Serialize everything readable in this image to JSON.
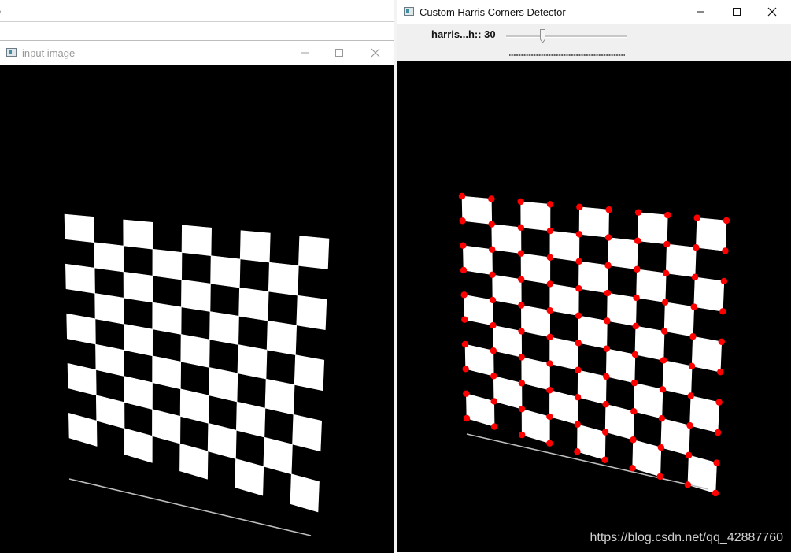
{
  "background_window": {
    "title_fragment": ","
  },
  "input_window": {
    "title": "input image",
    "icons": [
      "window-app-icon",
      "minimize-icon",
      "maximize-icon",
      "close-icon"
    ]
  },
  "detector_window": {
    "title": "Custom Harris Corners Detector",
    "icons": [
      "window-app-icon",
      "minimize-icon",
      "maximize-icon",
      "close-icon"
    ],
    "trackbar": {
      "label": "harris...h:: 30",
      "value": 30,
      "max": 100
    }
  },
  "watermark": "https://blog.csdn.net/qq_42887760",
  "colors": {
    "corner_marker": "#ff0000",
    "board_white": "#ffffff",
    "board_black": "#000000",
    "window_bg": "#ffffff",
    "toolbar_bg": "#f0f0f0"
  }
}
